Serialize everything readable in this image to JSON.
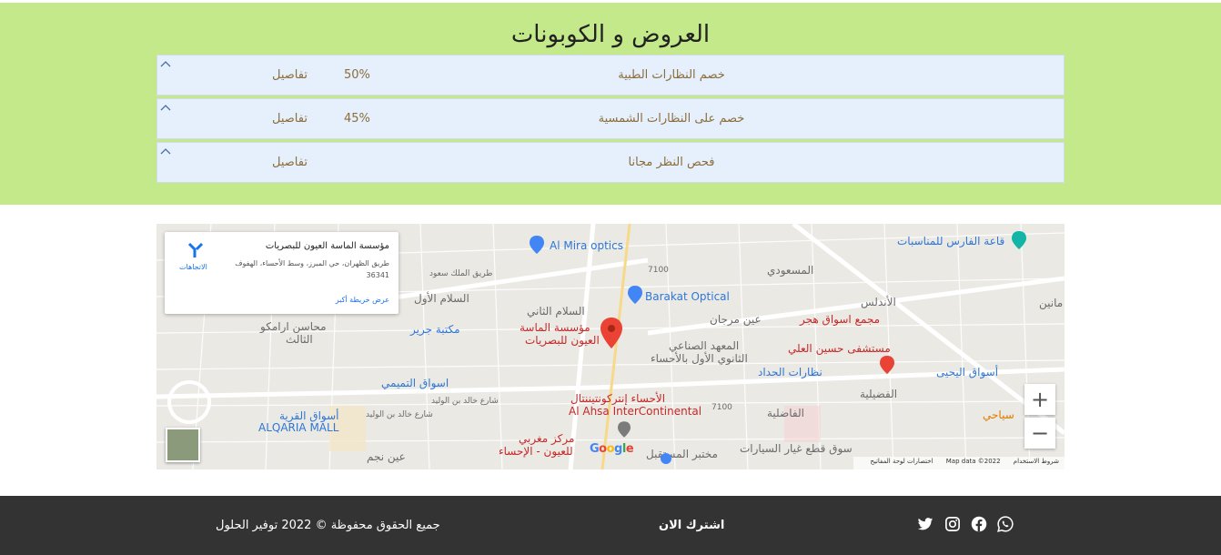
{
  "offers": {
    "title": "العروض و الكوبونات",
    "items": [
      {
        "name": "خصم النظارات الطبية",
        "percent": "50%",
        "details": "تفاصيل"
      },
      {
        "name": "خصم على النظارات الشمسية",
        "percent": "45%",
        "details": "تفاصيل"
      },
      {
        "name": "فحص النظر مجانا",
        "percent": "",
        "details": "تفاصيل"
      }
    ]
  },
  "map": {
    "card": {
      "place_name": "مؤسسة الماسة العيون للبصريات",
      "address": "طريق الظهران، حي المبرز، وسط الأحساء، الهفوف 36341",
      "larger_map": "عرض خريطة أكبر",
      "directions": "الاتجاهات"
    },
    "labels": {
      "al_mira": "Al Mira optics",
      "barakat": "Barakat Optical",
      "main_pin": "مؤسسة الماسة",
      "main_pin2": "العيون للبصريات",
      "intercon_ar": "الأحساء إنتركونتيننتال",
      "intercon_en": "Al Ahsa InterContinental",
      "maghribi": "مركز مغربي",
      "maghribi2": "للعيون - الإحساء",
      "qaryah_ar": "أسواق القرية",
      "qaryah_en": "ALQARIA MALL",
      "tamimi": "اسواق التميمي",
      "jarir": "مكتبة جرير",
      "hajar": "مجمع اسواق هجر",
      "hospital": "مستشفى حسين العلي",
      "haddad": "نظارات الحداد",
      "yahya": "أسواق اليحيى",
      "faris": "قاعة الفارس للمناسبات",
      "masoudi": "المسعودي",
      "salam2": "السلام الثاني",
      "salam1": "السلام الأول",
      "institute": "المعهد الصناعي",
      "school": "الثانوي الأول بالأحساء",
      "ain_marjan": "عين مرجان",
      "andalus": "الأندلس",
      "fadiliya": "الفضيلية",
      "fadila": "الفاضلية",
      "lab": "مختبر المستقبل",
      "spareparts": "سوق قطع غيار السيارات",
      "tourism": "سياحي",
      "ramco": "محاسن ارامكو",
      "ramco2": "الثالث",
      "ain_najm": "عين نجم",
      "road_7100a": "7100",
      "road_7100b": "7100",
      "mabeen": "مانين",
      "road1": "طريق الملك سعود",
      "road2": "شارع خالد بن الوليد",
      "road3": "شارع خالد بن الوليد"
    },
    "attribution": {
      "terms": "شروط الاستخدام",
      "data": "Map data ©2022",
      "shortcuts": "اختصارات لوحة المفاتيح"
    },
    "google": "Google",
    "zoom_in": "+",
    "zoom_out": "−"
  },
  "footer": {
    "copyright": "جميع الحقوق محفوظة © 2022 توفير الحلول",
    "subscribe": "اشترك الان",
    "social_icons": [
      "twitter-icon",
      "instagram-icon",
      "facebook-icon",
      "whatsapp-icon"
    ]
  },
  "colors": {
    "offers_bg": "#c4e98a",
    "row_bg": "#e5f0fc",
    "footer_bg": "#333333",
    "text_brown": "#8a6d3b"
  }
}
